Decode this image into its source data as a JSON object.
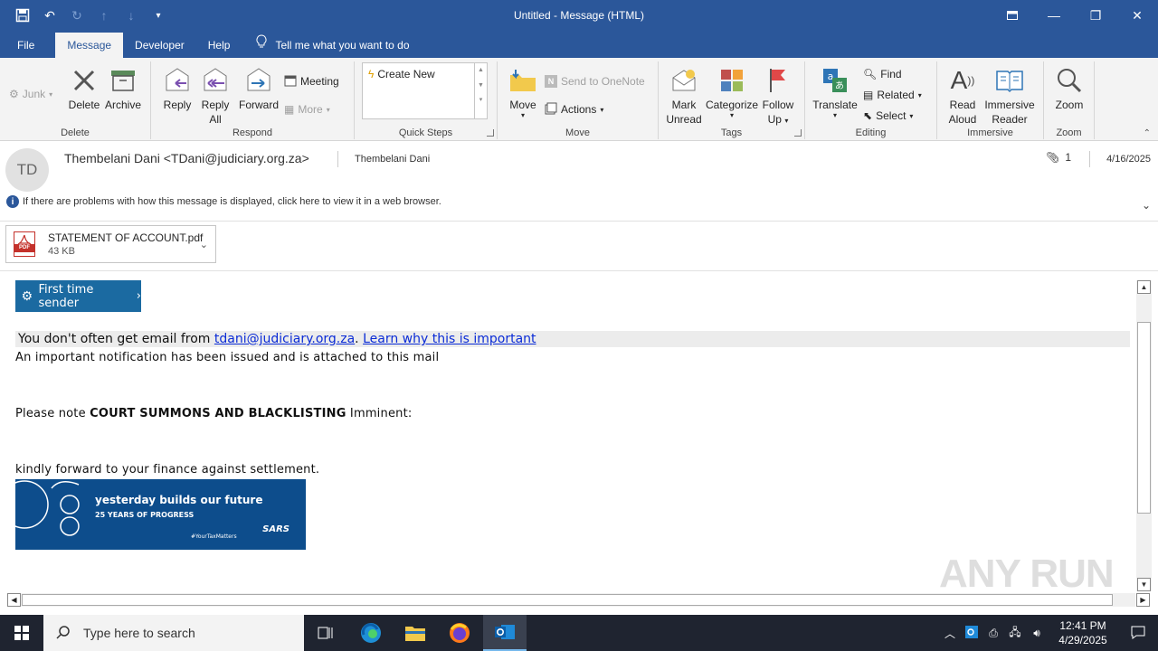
{
  "window": {
    "title": "Untitled  -  Message (HTML)"
  },
  "tabs": [
    {
      "label": "File"
    },
    {
      "label": "Message"
    },
    {
      "label": "Developer"
    },
    {
      "label": "Help"
    }
  ],
  "tell_me": "Tell me what you want to do",
  "ribbon": {
    "delete_group": {
      "label": "Delete",
      "junk": "Junk",
      "delete": "Delete",
      "archive": "Archive"
    },
    "respond_group": {
      "label": "Respond",
      "reply": "Reply",
      "reply_all_1": "Reply",
      "reply_all_2": "All",
      "forward": "Forward",
      "meeting": "Meeting",
      "more": "More"
    },
    "quick_steps_group": {
      "label": "Quick Steps",
      "create_new": "Create New"
    },
    "move_group": {
      "label": "Move",
      "move": "Move",
      "onenote": "Send to OneNote",
      "actions": "Actions"
    },
    "tags_group": {
      "label": "Tags",
      "mark_unread_1": "Mark",
      "mark_unread_2": "Unread",
      "categorize": "Categorize",
      "follow_up_1": "Follow",
      "follow_up_2": "Up"
    },
    "editing_group": {
      "label": "Editing",
      "translate": "Translate",
      "find": "Find",
      "related": "Related",
      "select": "Select"
    },
    "immersive_group": {
      "label": "Immersive",
      "read_aloud_1": "Read",
      "read_aloud_2": "Aloud",
      "immersive_reader_1": "Immersive",
      "immersive_reader_2": "Reader"
    },
    "zoom_group": {
      "label": "Zoom",
      "zoom": "Zoom"
    }
  },
  "message": {
    "avatar_initials": "TD",
    "from": "Thembelani Dani <TDani@judiciary.org.za>",
    "to": "Thembelani Dani",
    "attachment_count": "1",
    "date": "4/16/2025",
    "info_bar": "If there are problems with how this message is displayed, click here to view it in a web browser.",
    "attachment": {
      "name": "STATEMENT OF ACCOUNT.pdf",
      "size": "43 KB",
      "type_label": "PDF"
    }
  },
  "body": {
    "first_time_sender": "First time sender",
    "warning_prefix": "You don't often get email from ",
    "warning_email": "tdani@judiciary.org.za",
    "warning_sep": ". ",
    "warning_link": "Learn why this is important",
    "line1": "An important notification has been issued and is attached to this mail",
    "line2_prefix": "Please note ",
    "line2_bold": "COURT SUMMONS AND BLACKLISTING",
    "line2_suffix": " Imminent:",
    "line3": "kindly forward to your finance against settlement.",
    "banner": {
      "title": "yesterday builds our future",
      "subtitle": "25 YEARS OF PROGRESS",
      "hashtag": "#YourTaxMatters",
      "brand": "SARS"
    }
  },
  "watermark": "ANY RUN",
  "taskbar": {
    "search_placeholder": "Type here to search",
    "time": "12:41 PM",
    "date": "4/29/2025"
  },
  "colors": {
    "title_bar": "#2b579a",
    "ribbon": "#f3f3f3",
    "first_time_badge": "#1b6aa1",
    "banner": "#0d4d8c",
    "taskbar": "#1f2430"
  }
}
